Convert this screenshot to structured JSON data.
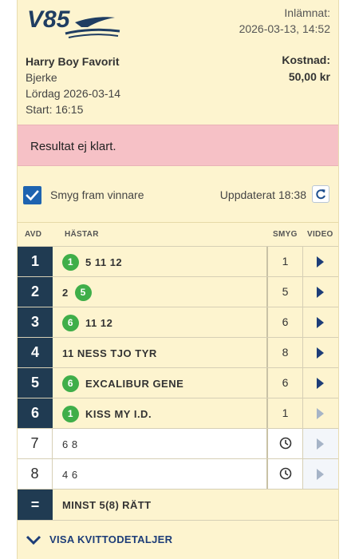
{
  "header": {
    "logo_text": "V85",
    "submitted_label": "Inlämnat:",
    "submitted_value": "2026-03-13, 14:52",
    "name": "Harry Boy Favorit",
    "track": "Bjerke",
    "date": "Lördag 2026-03-14",
    "start": "Start: 16:15",
    "cost_label": "Kostnad:",
    "cost_value": "50,00 kr"
  },
  "result_banner": {
    "text": "Resultat ej klart."
  },
  "controls": {
    "checkbox_checked": true,
    "smyg_label": "Smyg fram vinnare",
    "updated_text": "Uppdaterat 18:38"
  },
  "table": {
    "headers": {
      "avd": "AVD",
      "horses": "HÄSTAR",
      "smyg": "SMYG",
      "video": "VIDEO"
    },
    "rows": [
      {
        "avd": "1",
        "winner": "1",
        "before": "",
        "after": "5 11 12",
        "smyg": "1",
        "video": "active",
        "pending": false
      },
      {
        "avd": "2",
        "winner": "5",
        "before": "2",
        "after": "",
        "smyg": "5",
        "video": "active",
        "pending": false
      },
      {
        "avd": "3",
        "winner": "6",
        "before": "",
        "after": "11 12",
        "smyg": "6",
        "video": "active",
        "pending": false
      },
      {
        "avd": "4",
        "winner": "",
        "before": "",
        "after": "11 NESS TJO TYR",
        "smyg": "8",
        "video": "active",
        "pending": false
      },
      {
        "avd": "5",
        "winner": "6",
        "before": "",
        "after": "EXCALIBUR GENE",
        "smyg": "6",
        "video": "active",
        "pending": false
      },
      {
        "avd": "6",
        "winner": "1",
        "before": "",
        "after": "KISS MY I.D.",
        "smyg": "1",
        "video": "dim",
        "pending": false
      },
      {
        "avd": "7",
        "winner": "",
        "before": "",
        "after": "6 8",
        "smyg": "",
        "video": "dim",
        "pending": true
      },
      {
        "avd": "8",
        "winner": "",
        "before": "",
        "after": "4 6",
        "smyg": "",
        "video": "dim",
        "pending": true
      }
    ],
    "total": {
      "symbol": "=",
      "text": "MINST 5(8) RÄTT"
    }
  },
  "details_link": {
    "text": "VISA KVITTODETALJER"
  },
  "colors": {
    "card_bg": "#fdf4cf",
    "avd_bg": "#203b52",
    "winner_green": "#3fae49",
    "banner_pink": "#f6c1c6",
    "link_blue": "#1d3d78",
    "checkbox_blue": "#1e63b0"
  },
  "icons": {
    "checkbox": "checkmark-icon",
    "refresh": "refresh-icon",
    "video": "play-icon",
    "pending_smyg": "clock-icon",
    "details": "chevron-down-icon"
  }
}
